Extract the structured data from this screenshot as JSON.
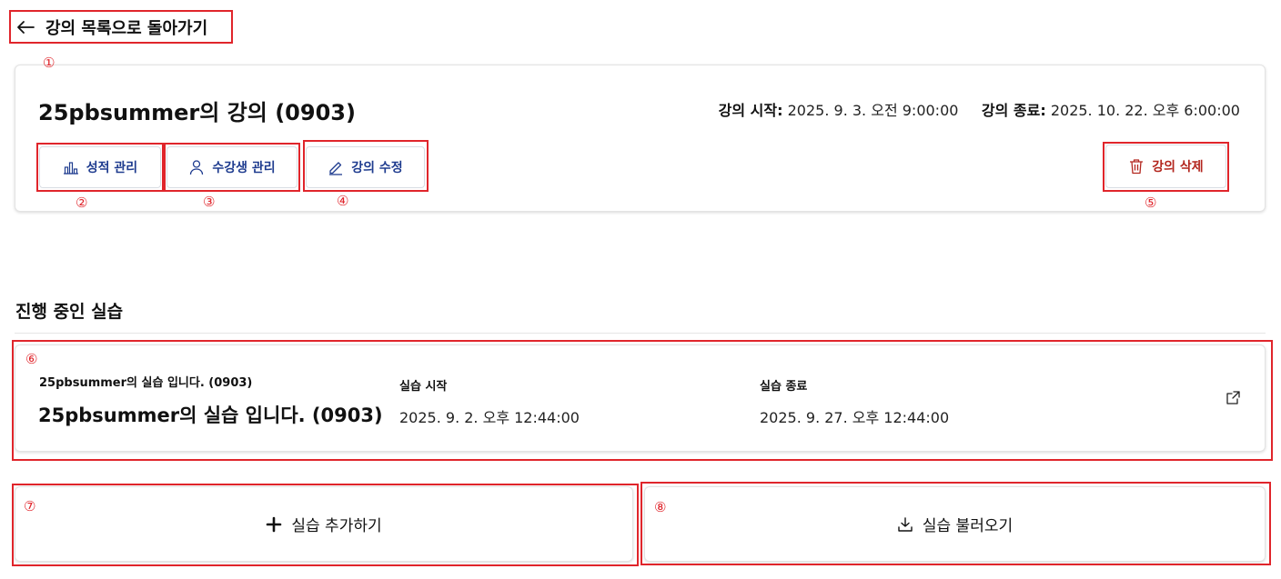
{
  "back": {
    "label": "강의 목록으로 돌아가기",
    "icon": "arrow-left-icon"
  },
  "course": {
    "title": "25pbsummer의 강의 (0903)",
    "start_label": "강의 시작:",
    "start_value": "2025. 9. 3. 오전 9:00:00",
    "end_label": "강의 종료:",
    "end_value": "2025. 10. 22. 오후 6:00:00",
    "buttons": {
      "grades": "성적 관리",
      "students": "수강생 관리",
      "edit": "강의 수정",
      "delete": "강의 삭제"
    }
  },
  "section": {
    "title": "진행 중인 실습"
  },
  "practice": {
    "subtitle": "25pbsummer의 실습 입니다. (0903)",
    "title": "25pbsummer의 실습 입니다. (0903)",
    "start_label": "실습 시작",
    "start_value": "2025. 9. 2. 오후 12:44:00",
    "end_label": "실습 종료",
    "end_value": "2025. 9. 27. 오후 12:44:00"
  },
  "actions": {
    "add": "실습 추가하기",
    "import": "실습 불러오기"
  },
  "annotations": [
    "①",
    "②",
    "③",
    "④",
    "⑤",
    "⑥",
    "⑦",
    "⑧"
  ],
  "colors": {
    "annotation_red": "#e0252b",
    "button_blue": "#1f3c8f",
    "delete_red": "#b3261e"
  }
}
